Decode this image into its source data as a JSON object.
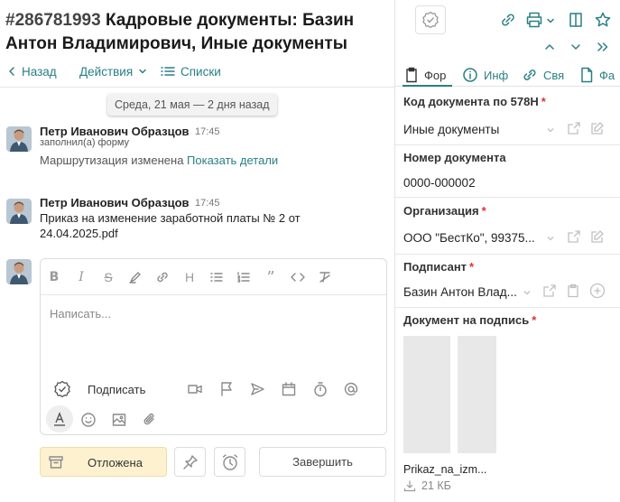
{
  "header": {
    "doc_number": "#286781993",
    "doc_title": "Кадровые документы: Базин Антон Владимирович, Иные документы"
  },
  "nav": {
    "back_label": "Назад",
    "actions_label": "Действия",
    "lists_label": "Списки"
  },
  "feed": {
    "date_divider": "Среда, 21 мая — 2 дня назад",
    "messages": [
      {
        "author": "Петр Иванович Образцов",
        "time": "17:45",
        "sub": "заполнил(а) форму",
        "text": "Маршрутизация изменена",
        "link": "Показать детали"
      },
      {
        "author": "Петр Иванович Образцов",
        "time": "17:45",
        "text": "Приказ на изменение заработной платы № 2 от 24.04.2025.pdf"
      }
    ]
  },
  "editor": {
    "placeholder": "Написать...",
    "sign_label": "Подписать"
  },
  "bottom_bar": {
    "postponed_label": "Отложена",
    "finish_label": "Завершить"
  },
  "tabs": [
    {
      "label": "Фор",
      "icon": "clipboard-icon"
    },
    {
      "label": "Инф",
      "icon": "info-icon"
    },
    {
      "label": "Свя",
      "icon": "link-icon"
    },
    {
      "label": "Фа",
      "icon": "file-icon"
    }
  ],
  "form": {
    "fields": [
      {
        "label": "Код документа по 578Н",
        "required": "*",
        "value": "Иные документы"
      },
      {
        "label": "Номер документа",
        "value": "0000-000002"
      },
      {
        "label": "Организация",
        "required": "*",
        "value": "ООО \"БестКо\", 99375..."
      },
      {
        "label": "Подписант",
        "required": "*",
        "value": "Базин Антон Влад..."
      },
      {
        "label": "Документ на подпись",
        "required": "*"
      }
    ],
    "attachment": {
      "name": "Prikaz_na_izm...",
      "size": "21 КБ"
    }
  },
  "colors": {
    "accent": "#2a7f83",
    "required": "#d33333",
    "postponed_bg": "#fdf1d0"
  }
}
